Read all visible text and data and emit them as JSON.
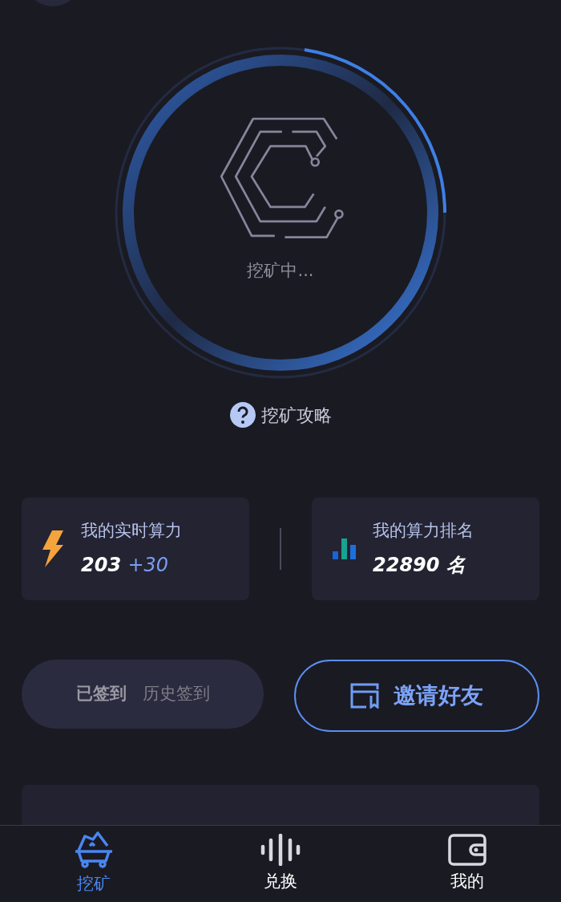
{
  "mining": {
    "status": "挖矿中..."
  },
  "guide_link": "挖矿攻略",
  "stats": [
    {
      "kind": "power",
      "label": "我的实时算力",
      "value": "203",
      "delta": "+30"
    },
    {
      "kind": "rank",
      "label": "我的算力排名",
      "value": "22890 名"
    }
  ],
  "signin": {
    "done": "已签到",
    "history": "历史签到"
  },
  "invite": "邀请好友",
  "nav": [
    {
      "kind": "mine",
      "label": "挖矿",
      "selected": true
    },
    {
      "kind": "exchange",
      "label": "兑换",
      "selected": false
    },
    {
      "kind": "wallet",
      "label": "我的",
      "selected": false
    }
  ]
}
